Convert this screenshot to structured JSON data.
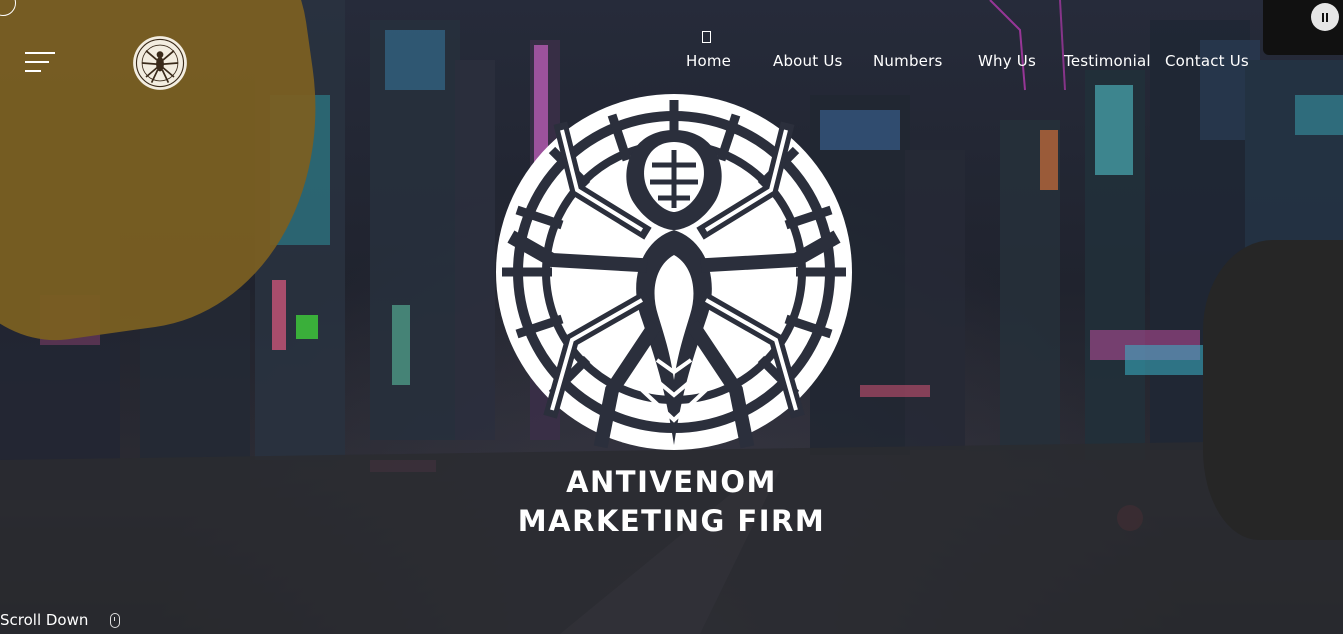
{
  "nav": {
    "items": [
      {
        "label": "Home"
      },
      {
        "label": "About Us"
      },
      {
        "label": "Numbers"
      },
      {
        "label": "Why Us"
      },
      {
        "label": "Testimonial"
      },
      {
        "label": "Contact Us"
      }
    ]
  },
  "hero": {
    "title_line1": "ANTIVENOM",
    "title_line2": "MARKETING FIRM"
  },
  "scroll": {
    "label": "Scroll Down"
  },
  "colors": {
    "accent_blob": "#7a5f22",
    "text": "#ffffff",
    "background": "#1c1c24"
  },
  "icons": {
    "menu": "hamburger-icon",
    "logo": "spider-emblem-logo",
    "audio": "pause-icon",
    "scroll": "mouse-icon"
  }
}
